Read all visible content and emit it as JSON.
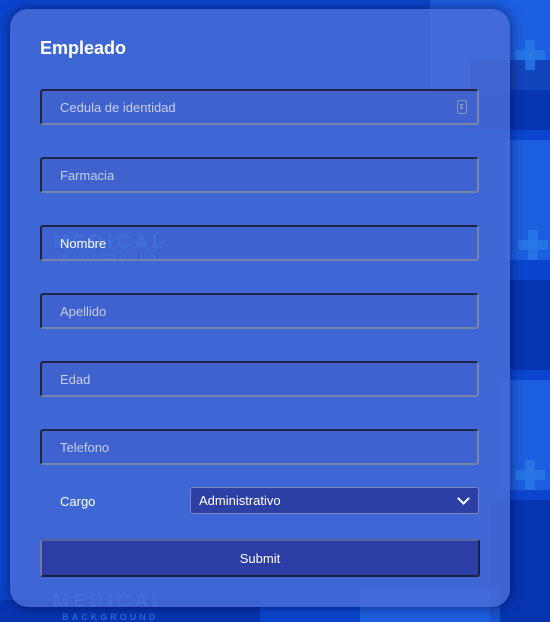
{
  "form": {
    "title": "Empleado",
    "fields": [
      {
        "placeholder": "Cedula de identidad",
        "icon": "id-card-icon"
      },
      {
        "placeholder": "Farmacia"
      },
      {
        "placeholder": "Nombre"
      },
      {
        "placeholder": "Apellido"
      },
      {
        "placeholder": "Edad"
      },
      {
        "placeholder": "Telefono"
      }
    ],
    "cargo": {
      "label": "Cargo",
      "selected": "Administrativo"
    },
    "submit_label": "Submit"
  },
  "background": {
    "watermark_main": "MEDICAL",
    "watermark_sub": "BACKGROUND"
  },
  "colors": {
    "card": "#4a6cd6",
    "background": "#0b45cf",
    "button": "#2c3ea5"
  }
}
